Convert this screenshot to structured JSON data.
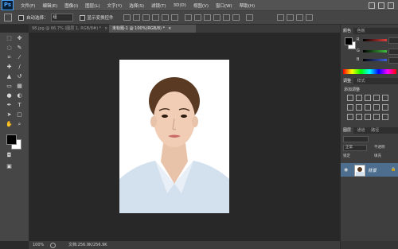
{
  "app": {
    "logo": "Ps"
  },
  "menu": [
    "文件(F)",
    "编辑(E)",
    "图像(I)",
    "图层(L)",
    "文字(Y)",
    "选择(S)",
    "滤镜(T)",
    "3D(D)",
    "视图(V)",
    "窗口(W)",
    "帮助(H)"
  ],
  "options": {
    "auto_select_label": "自动选择：",
    "auto_select_value": "组",
    "show_transform_label": "显示变换控件"
  },
  "tabs": [
    {
      "label": "98.jpg @ 66.7% (图层 1, RGB/8#) *",
      "active": false
    },
    {
      "label": "未标题-1 @ 100%(RGB/8) *",
      "active": true
    }
  ],
  "status": {
    "zoom": "100%",
    "doc_info": "文档:256.9K/256.9K"
  },
  "color_panel": {
    "tabs": [
      "颜色",
      "色板"
    ],
    "sliders": [
      {
        "label": "R",
        "color": "#e04040"
      },
      {
        "label": "G",
        "color": "#40c040"
      },
      {
        "label": "B",
        "color": "#4060e0"
      }
    ]
  },
  "adjust_panel": {
    "tabs": [
      "调整",
      "样式"
    ],
    "title": "添加调整"
  },
  "layers_panel": {
    "tabs": [
      "图层",
      "通道",
      "路径"
    ],
    "blend_mode": "正常",
    "opacity_label": "不透明",
    "lock_label": "锁定",
    "fill_label": "填充",
    "layer_name": "背景"
  },
  "colors": {
    "foreground": "#000000",
    "background": "#ffffff",
    "selected_layer": "#4d6e8e",
    "hair": "#5a3a22",
    "skin": "#f1cdb6",
    "shirt": "#d3e0ee"
  }
}
